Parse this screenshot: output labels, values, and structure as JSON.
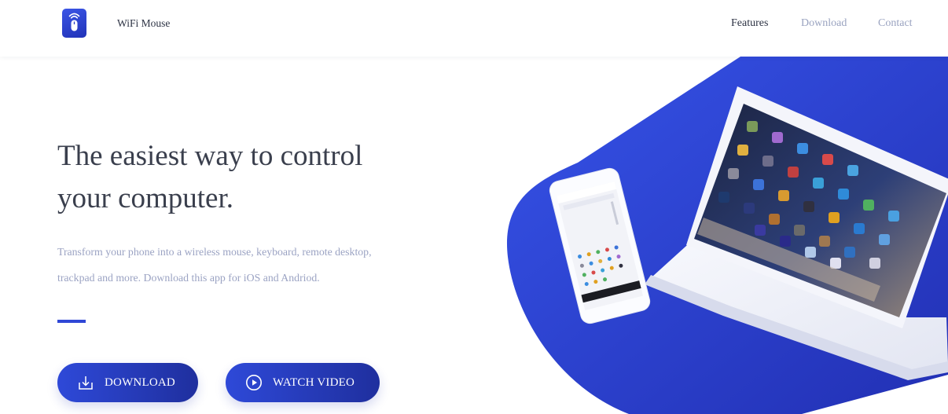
{
  "header": {
    "brand_name": "WiFi Mouse",
    "logo_icon": "mouse-wifi-icon",
    "nav": [
      {
        "label": "Features",
        "active": true
      },
      {
        "label": "Download",
        "active": false
      },
      {
        "label": "Contact",
        "active": false
      }
    ]
  },
  "hero": {
    "headline_line1": "The easiest way to control",
    "headline_line2": "your computer.",
    "description_line1": "Transform your phone into a wireless mouse, keyboard, remote desktop,",
    "description_line2": "trackpad and more. Download this app for iOS and Andriod.",
    "buttons": {
      "download_label": "DOWNLOAD",
      "download_icon": "download-icon",
      "video_label": "WATCH VIDEO",
      "video_icon": "play-circle-icon"
    },
    "illustration": {
      "devices": [
        "smartphone",
        "laptop"
      ],
      "background_shape": "blue-diagonal-blob"
    }
  },
  "colors": {
    "accent": "#2f47d6",
    "button_gradient_start": "#2e49d8",
    "button_gradient_end": "#1f2f9e",
    "heading": "#3a3f4d",
    "muted_text": "#9ba3c3",
    "nav_muted": "#9aa3c0"
  }
}
